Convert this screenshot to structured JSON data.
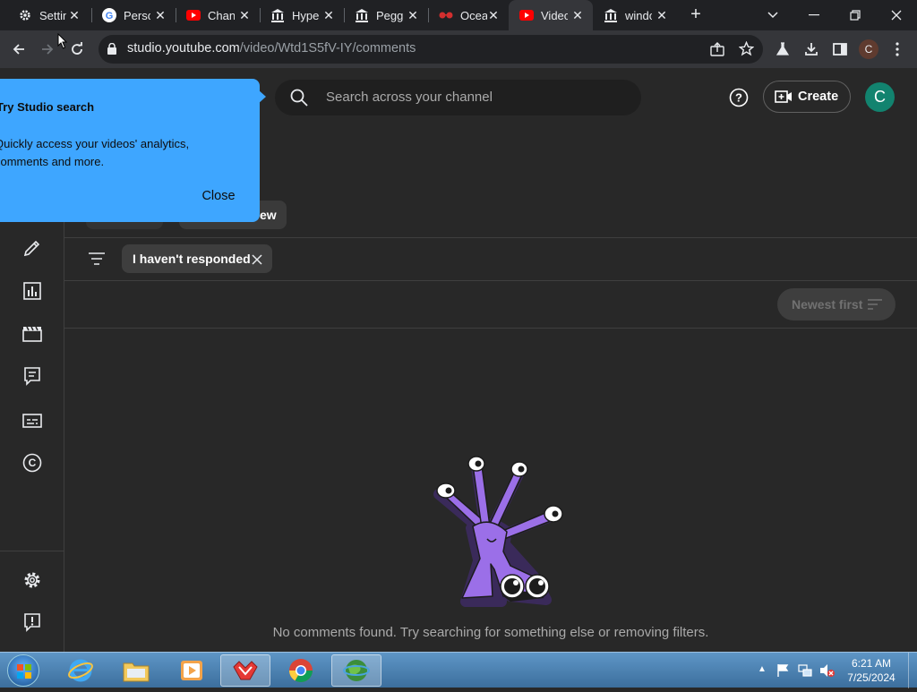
{
  "browser": {
    "tabs": [
      {
        "title": "Settings",
        "icon": "gear-icon"
      },
      {
        "title": "Personal",
        "icon": "google-icon"
      },
      {
        "title": "Channel",
        "icon": "youtube-icon"
      },
      {
        "title": "Hyperlinks",
        "icon": "bank-icon"
      },
      {
        "title": "Pegging",
        "icon": "bank-icon"
      },
      {
        "title": "Ocean",
        "icon": "glasses-icon"
      },
      {
        "title": "Video comments",
        "icon": "youtube-icon"
      },
      {
        "title": "windows",
        "icon": "bank-icon"
      }
    ],
    "active_tab_index": 6,
    "url_host": "studio.youtube.com",
    "url_path": "/video/Wtd1S5fV-IY/comments",
    "profile_initial": "C"
  },
  "studio": {
    "search_placeholder": "Search across your channel",
    "create_label": "Create",
    "avatar_initial": "C",
    "filter_chip_label": "I haven't responded",
    "partial_chip_label": "ew",
    "sort_label": "Newest first",
    "empty_message": "No comments found. Try searching for something else or removing filters.",
    "rail_icons": [
      "edit-icon",
      "analytics-icon",
      "editor-icon",
      "comments-icon",
      "subtitles-icon",
      "copyright-icon",
      "settings-icon",
      "feedback-icon"
    ]
  },
  "popover": {
    "title": "Try Studio search",
    "body": "Quickly access your videos' analytics, comments and more.",
    "close_label": "Close",
    "color": "#3ea6ff"
  },
  "taskbar": {
    "time": "6:21 AM",
    "date": "7/25/2024"
  }
}
